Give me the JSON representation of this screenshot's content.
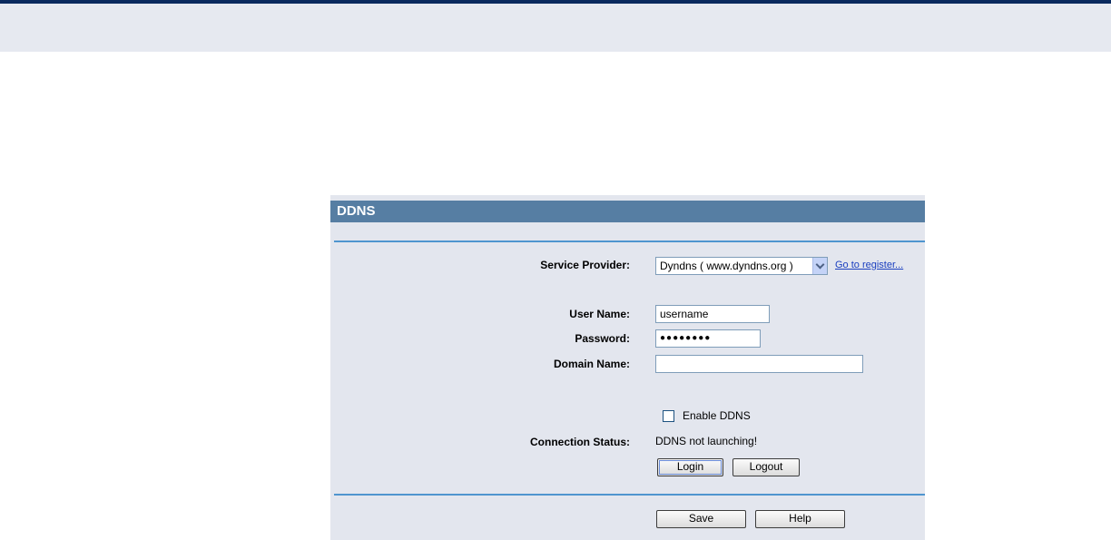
{
  "panel": {
    "title": "DDNS"
  },
  "form": {
    "service_provider": {
      "label": "Service Provider:",
      "selected": "Dyndns ( www.dyndns.org )",
      "register_link": "Go to register..."
    },
    "user_name": {
      "label": "User Name:",
      "value": "username"
    },
    "password": {
      "label": "Password:",
      "value": "●●●●●●●●"
    },
    "domain_name": {
      "label": "Domain Name:",
      "value": ""
    },
    "enable_ddns": {
      "label": "Enable DDNS",
      "checked": false
    },
    "connection_status": {
      "label": "Connection Status:",
      "value": "DDNS not launching!"
    },
    "buttons": {
      "login": "Login",
      "logout": "Logout",
      "save": "Save",
      "help": "Help"
    }
  },
  "colors": {
    "header_bg": "#567ea3",
    "panel_bg": "#e3e6ee",
    "divider": "#4f95cf",
    "top_border": "#0a2a5e"
  }
}
